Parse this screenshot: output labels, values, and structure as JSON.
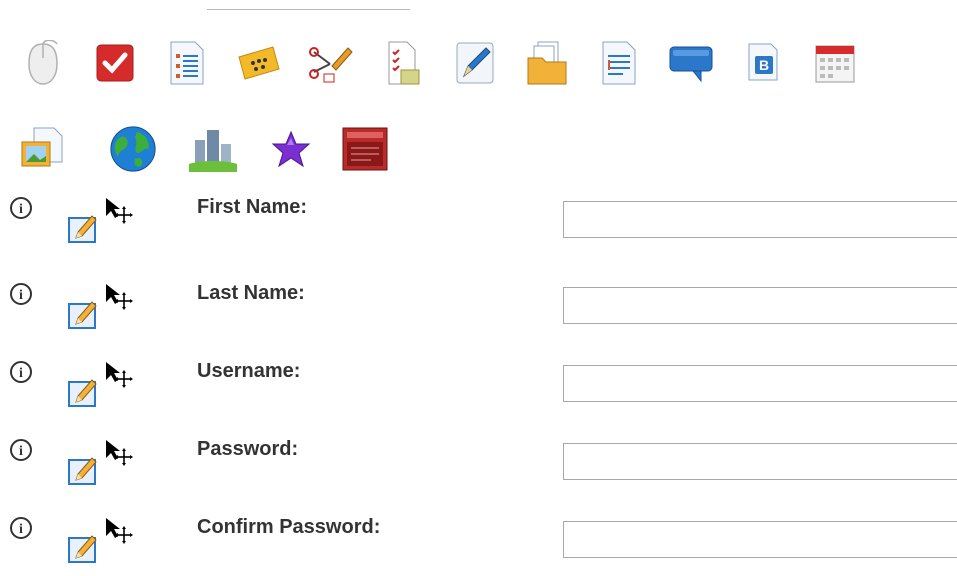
{
  "toolbar": {
    "row1": [
      {
        "icon": "mouse-icon"
      },
      {
        "icon": "checkbox-icon"
      },
      {
        "icon": "numbered-list-icon"
      },
      {
        "icon": "rating-ticket-icon"
      },
      {
        "icon": "scissors-edit-icon"
      },
      {
        "icon": "checklist-document-icon"
      },
      {
        "icon": "pencil-edit-icon"
      },
      {
        "icon": "folder-documents-icon"
      },
      {
        "icon": "text-document-icon"
      },
      {
        "icon": "speech-bubble-icon"
      },
      {
        "icon": "bold-text-icon"
      },
      {
        "icon": "calendar-icon"
      }
    ],
    "row2": [
      {
        "icon": "image-document-icon"
      },
      {
        "icon": "globe-icon"
      },
      {
        "icon": "city-buildings-icon"
      },
      {
        "icon": "purple-star-icon"
      },
      {
        "icon": "red-panel-icon"
      }
    ]
  },
  "form": {
    "fields": [
      {
        "label": "First Name:",
        "value": ""
      },
      {
        "label": "Last Name:",
        "value": ""
      },
      {
        "label": "Username:",
        "value": ""
      },
      {
        "label": "Password:",
        "value": ""
      },
      {
        "label": "Confirm Password:",
        "value": ""
      }
    ]
  },
  "colors": {
    "label_text": "#333333",
    "input_border": "#a9a9a9",
    "accent_blue": "#2b77c9",
    "accent_red": "#d62b2b"
  }
}
